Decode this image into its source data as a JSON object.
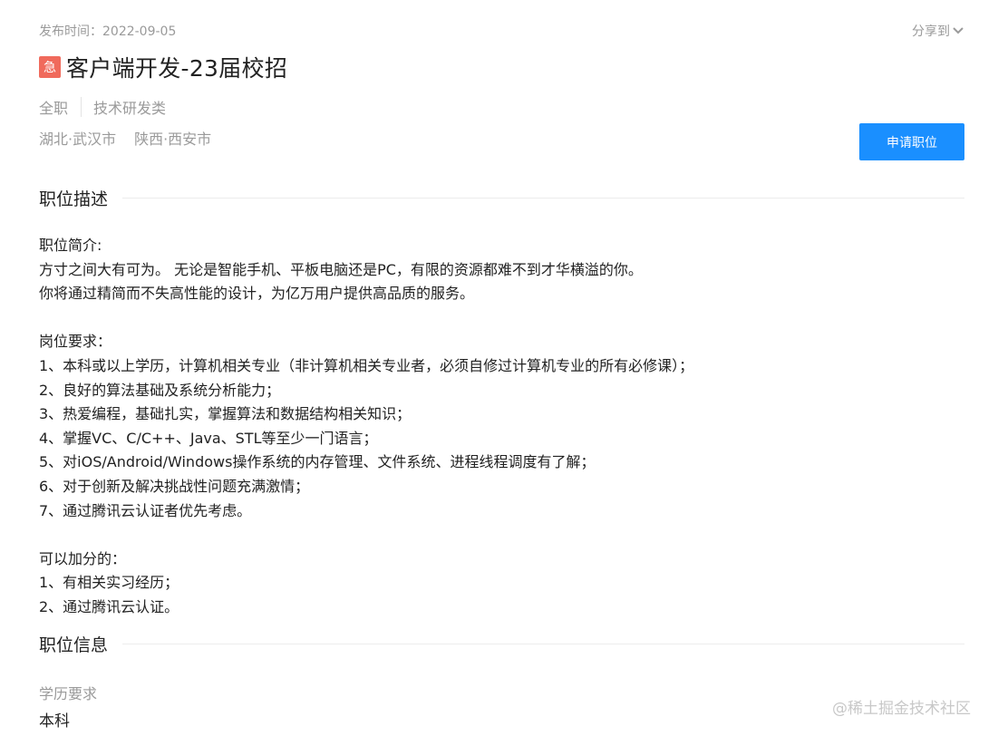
{
  "header": {
    "publish_time": "发布时间：2022-09-05",
    "share_label": "分享到",
    "urgent_badge": "急",
    "job_title": "客户端开发-23届校招",
    "tags": [
      "全职",
      "技术研发类"
    ],
    "locations": [
      "湖北·武汉市",
      "陕西·西安市"
    ],
    "apply_label": "申请职位"
  },
  "description": {
    "section_title": "职位描述",
    "intro_heading": "职位简介:",
    "intro_lines": [
      "方寸之间大有可为。 无论是智能手机、平板电脑还是PC，有限的资源都难不到才华横溢的你。",
      "你将通过精简而不失高性能的设计，为亿万用户提供高品质的服务。"
    ],
    "req_heading": "岗位要求：",
    "req_lines": [
      "1、本科或以上学历，计算机相关专业（非计算机相关专业者，必须自修过计算机专业的所有必修课）；",
      "2、良好的算法基础及系统分析能力；",
      "3、热爱编程，基础扎实，掌握算法和数据结构相关知识；",
      "4、掌握VC、C/C++、Java、STL等至少一门语言；",
      "5、对iOS/Android/Windows操作系统的内存管理、文件系统、进程线程调度有了解；",
      "6、对于创新及解决挑战性问题充满激情；",
      "7、通过腾讯云认证者优先考虑。"
    ],
    "bonus_heading": "可以加分的：",
    "bonus_lines": [
      "1、有相关实习经历；",
      "2、通过腾讯云认证。"
    ]
  },
  "info": {
    "section_title": "职位信息",
    "education_label": "学历要求",
    "education_value": "本科"
  },
  "watermark": "@稀土掘金技术社区",
  "colors": {
    "accent": "#1a8fff",
    "urgent": "#f06a5c",
    "muted_text": "#9a9a9a"
  }
}
